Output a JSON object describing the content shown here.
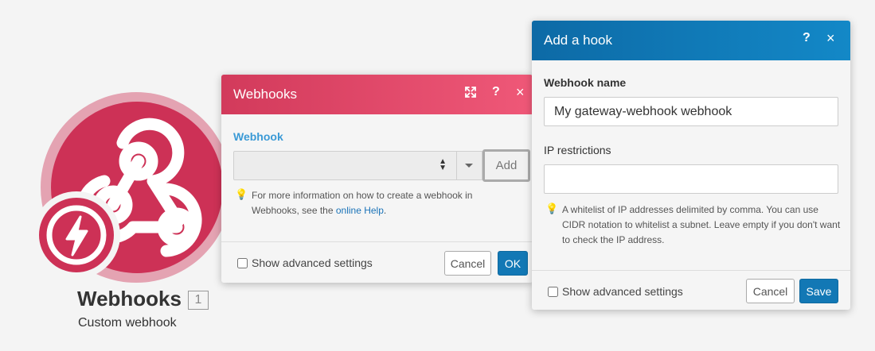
{
  "module": {
    "name": "Webhooks",
    "id": "1",
    "subtitle": "Custom webhook",
    "color": "#cd3156",
    "icon": "webhook-icon",
    "badge_icon": "lightning-icon"
  },
  "webhooks_dialog": {
    "title": "Webhooks",
    "expand_icon": "expand-icon",
    "help_label": "?",
    "close_label": "×",
    "field_label": "Webhook",
    "select_value": "",
    "add_label": "Add",
    "hint_before": "For more information on how to create a webhook in Webhooks, see the ",
    "hint_link": "online Help",
    "hint_after": ".",
    "advanced_label": "Show advanced settings",
    "cancel_label": "Cancel",
    "ok_label": "OK",
    "header_colors": [
      "#d23a5b",
      "#ef5878"
    ]
  },
  "hook_dialog": {
    "title": "Add a hook",
    "help_label": "?",
    "close_label": "×",
    "name_label": "Webhook name",
    "name_value": "My gateway-webhook webhook",
    "ip_label": "IP restrictions",
    "ip_value": "",
    "ip_hint": "A whitelist of IP addresses delimited by comma. You can use CIDR notation to whitelist a subnet. Leave empty if you don't want to check the IP address.",
    "advanced_label": "Show advanced settings",
    "cancel_label": "Cancel",
    "save_label": "Save",
    "header_colors": [
      "#0d6aa6",
      "#1388c7"
    ]
  }
}
